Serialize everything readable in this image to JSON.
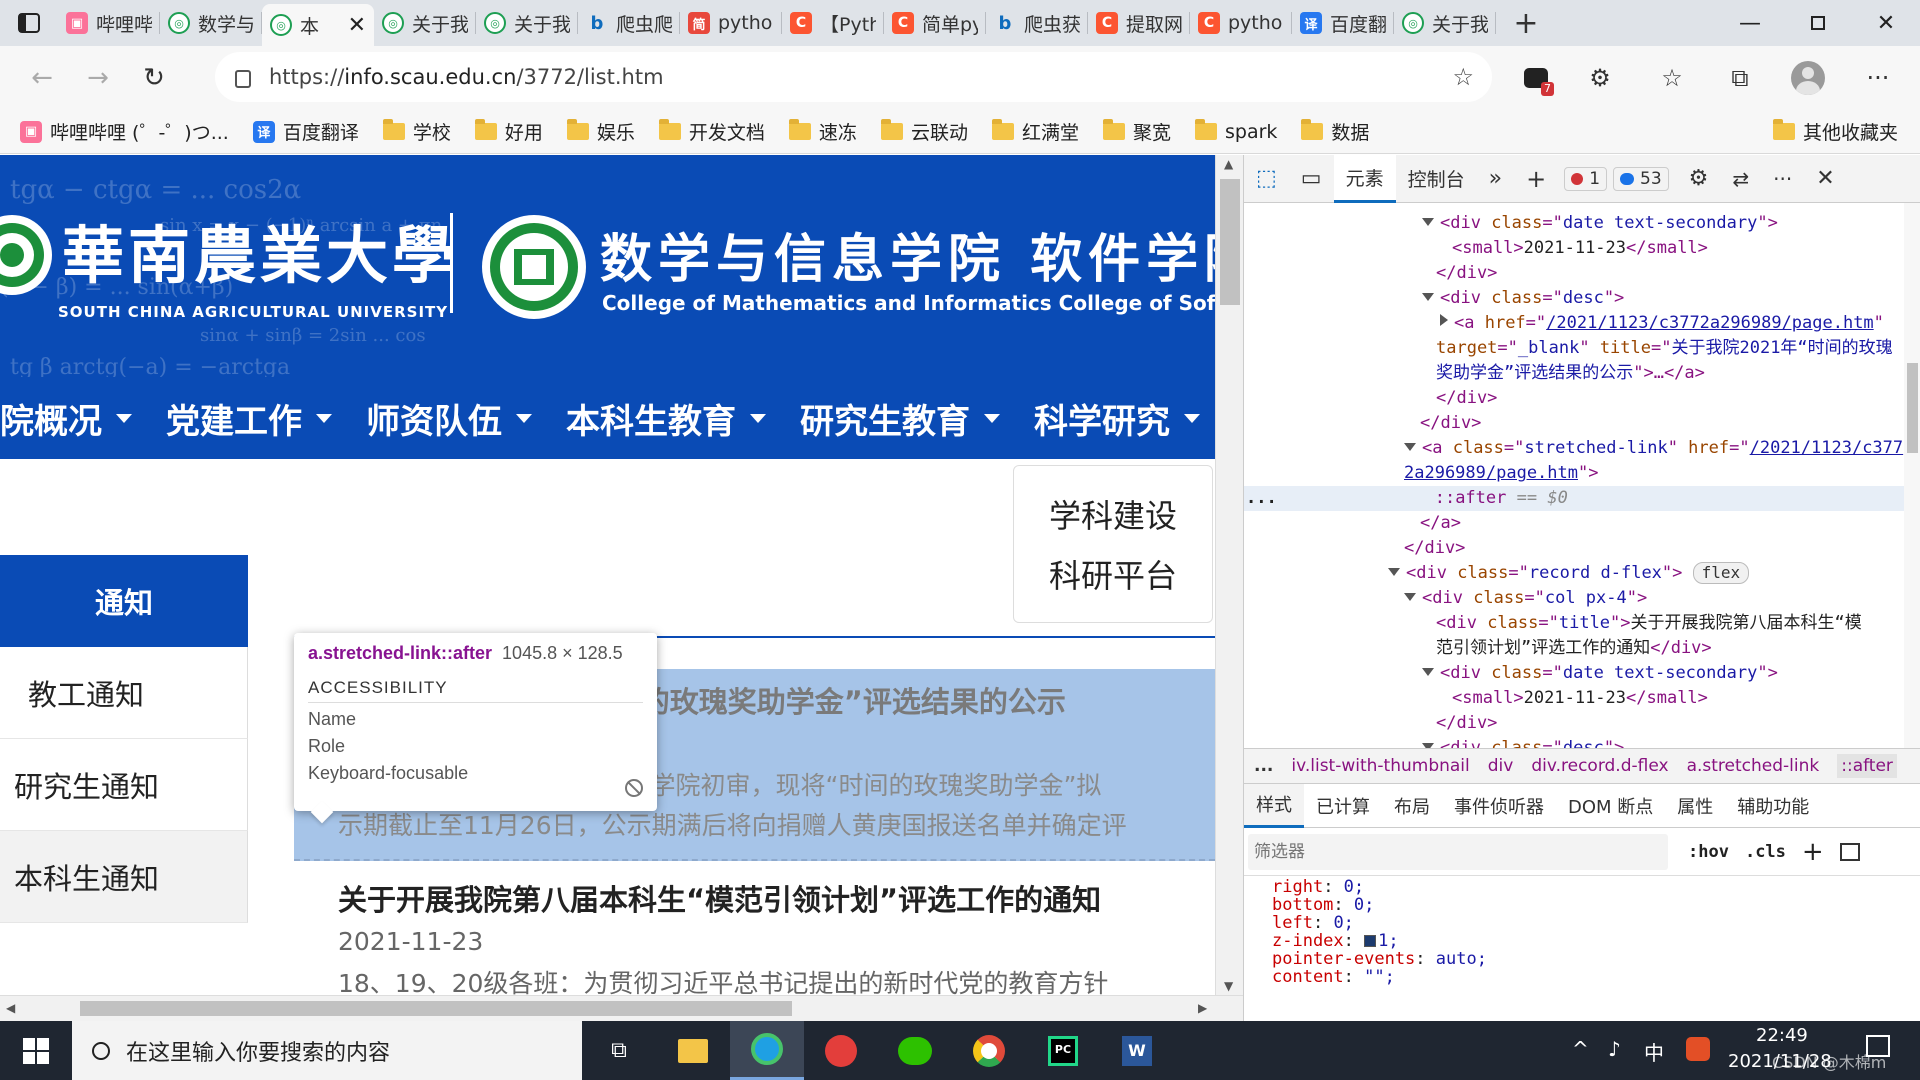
{
  "browser": {
    "tabs": [
      {
        "icon": "bilibili-icon",
        "label": "哔哩哔"
      },
      {
        "icon": "scau-icon",
        "label": "数学与"
      },
      {
        "icon": "scau-icon",
        "label": "本",
        "active": true
      },
      {
        "icon": "scau-icon",
        "label": "关于我"
      },
      {
        "icon": "scau-icon",
        "label": "关于我"
      },
      {
        "icon": "bing-icon",
        "label": "爬虫爬"
      },
      {
        "icon": "jianshu-icon",
        "label": "python"
      },
      {
        "icon": "csdn-icon",
        "label": "【Pyth"
      },
      {
        "icon": "csdn-icon",
        "label": "简单py"
      },
      {
        "icon": "bing-icon",
        "label": "爬虫获"
      },
      {
        "icon": "csdn-icon",
        "label": "提取网"
      },
      {
        "icon": "csdn-icon",
        "label": "python"
      },
      {
        "icon": "fanyi-icon",
        "label": "百度翻"
      },
      {
        "icon": "scau-icon",
        "label": "关于我"
      }
    ],
    "url_prefix": "https://",
    "url_host": "info.scau.edu.cn",
    "url_path": "/3772/list.htm",
    "extension_badge": "7",
    "bookmarks": [
      {
        "icon": "bilibili-icon",
        "label": "哔哩哔哩 (゜-゜)つ..."
      },
      {
        "icon": "fanyi-icon",
        "label": "百度翻译"
      },
      {
        "icon": "folder-icon",
        "label": "学校"
      },
      {
        "icon": "folder-icon",
        "label": "好用"
      },
      {
        "icon": "folder-icon",
        "label": "娱乐"
      },
      {
        "icon": "folder-icon",
        "label": "开发文档"
      },
      {
        "icon": "folder-icon",
        "label": "速冻"
      },
      {
        "icon": "folder-icon",
        "label": "云联动"
      },
      {
        "icon": "folder-icon",
        "label": "红满堂"
      },
      {
        "icon": "folder-icon",
        "label": "聚宽"
      },
      {
        "icon": "folder-icon",
        "label": "spark"
      },
      {
        "icon": "folder-icon",
        "label": "数据"
      }
    ],
    "other_bookmarks": "其他收藏夹"
  },
  "site": {
    "univ_cn": "華南農業大學",
    "univ_en": "SOUTH CHINA AGRICULTURAL UNIVERSITY",
    "college_cn": "数学与信息学院 软件学院",
    "college_en": "College of Mathematics and Informatics  College of Software Engineering",
    "menu": [
      "院概况",
      "党建工作",
      "师资队伍",
      "本科生教育",
      "研究生教育",
      "科学研究"
    ],
    "sidebar": [
      "通知",
      "教工通知",
      "研究生通知",
      "本科生通知"
    ],
    "category_box": [
      "学科建设",
      "科研平台"
    ],
    "records": [
      {
        "title": "关于我院2021年“时间的玫瑰奖助学金”评选结果的公示",
        "date": "2021-11-23",
        "desc": "各位同学：　　经个人申请、学院初审，现将“时间的玫瑰奖助学金”拟",
        "desc2": "示期截止至11月26日，公示期满后将向捐赠人黄庚国报送名单并确定评"
      },
      {
        "title": "关于开展我院第八届本科生“模范引领计划”评选工作的通知",
        "date": "2021-11-23",
        "desc": "18、19、20级各班：为贯彻习近平总书记提出的新时代党的教育方针"
      }
    ],
    "tooltip": {
      "selector": "a.stretched-link::after",
      "size": "1045.8 × 128.5",
      "heading": "ACCESSIBILITY",
      "rows": [
        "Name",
        "Role",
        "Keyboard-focusable"
      ]
    }
  },
  "devtools": {
    "tabs": {
      "elements": "元素",
      "console": "控制台"
    },
    "errors": "1",
    "messages": "53",
    "dom": {
      "date_class": "date text-secondary",
      "date_value": "2021-11-23",
      "desc_class": "desc",
      "link_href": "/2021/1123/c3772a296989/page.htm",
      "link_target": "_blank",
      "link_title_1": "关于我院2021年“时间的玫瑰",
      "link_title_2": "奖助学金”评选结果的公示",
      "stretched_class": "stretched-link",
      "stretched_href_1": "/2021/1123/c377",
      "stretched_href_2": "2a296989/page.htm",
      "pseudo": "::after",
      "pseudo_eq": "== $0",
      "record_class": "record d-flex",
      "flex_badge": "flex",
      "col_class": "col px-4",
      "title_class": "title",
      "title_text_1": "关于开展我院第八届本科生“模",
      "title_text_2": "范引领计划”评选工作的通知"
    },
    "breadcrumb": [
      "...",
      "iv.list-with-thumbnail",
      "div",
      "div.record.d-flex",
      "a.stretched-link",
      "::after"
    ],
    "style_tabs": [
      "样式",
      "已计算",
      "布局",
      "事件侦听器",
      "DOM 断点",
      "属性",
      "辅助功能"
    ],
    "filter_placeholder": "筛选器",
    "hov": ":hov",
    "cls": ".cls",
    "css_rules": [
      {
        "prop": "right",
        "value": "0;"
      },
      {
        "prop": "bottom",
        "value": "0;"
      },
      {
        "prop": "left",
        "value": "0;"
      },
      {
        "prop": "z-index",
        "value": "1;"
      },
      {
        "prop": "pointer-events",
        "value": "auto;"
      },
      {
        "prop": "content",
        "value": "\"\";"
      }
    ]
  },
  "taskbar": {
    "search_placeholder": "在这里输入你要搜索的内容",
    "ime": "中",
    "time": "22:49",
    "date": "2021/11/28",
    "watermark": "CSDN @木棉m"
  }
}
